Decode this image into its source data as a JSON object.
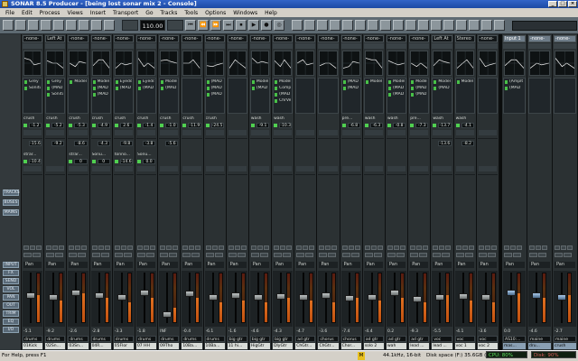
{
  "window": {
    "title": "SONAR 8.5 Producer - [being lost sonar mix 2 - Console]"
  },
  "menu": [
    "File",
    "Edit",
    "Process",
    "Views",
    "Insert",
    "Transport",
    "Go",
    "Tracks",
    "Tools",
    "Options",
    "Windows",
    "Help"
  ],
  "toolbar": {
    "now_time": "110.00"
  },
  "sidebar": [
    "TRACKS",
    "BUSES",
    "MAINS",
    "INPUT",
    "FX",
    "SEND",
    "VOL",
    "PAN",
    "OUT",
    "TRIM",
    "EQ",
    "I/O"
  ],
  "strips": [
    {
      "hdr": "-none-",
      "send": "crush",
      "send_val": "-1.2",
      "send2": "-15.6",
      "send3": "strar...",
      "send3_val": "-10.4",
      "pan": "Pan",
      "vol": "-5.1",
      "out": "drums",
      "name": "01Kick",
      "fx": [
        "Grey",
        "Sonitus"
      ],
      "meter": 0.55,
      "fader": 0.55
    },
    {
      "hdr": "Left At",
      "send": "crush",
      "send_val": "-5.2",
      "send2": "-9.2",
      "send3": "",
      "send3_val": "",
      "pan": "Pan",
      "vol": "-9.2",
      "out": "drums",
      "name": "02Sn...",
      "fx": [
        "Grey",
        "(MAD",
        "Sonitus"
      ],
      "meter": 0.45,
      "fader": 0.5
    },
    {
      "hdr": "-none-",
      "send": "crush",
      "send_val": "-5.3",
      "send2": "-8.6",
      "send3": "strar...",
      "send3_val": "0",
      "pan": "Pan",
      "vol": "-2.6",
      "out": "drums",
      "name": "03Sn...",
      "fx": [
        "Model"
      ],
      "meter": 0.6,
      "fader": 0.6
    },
    {
      "hdr": "-none-",
      "send": "crush",
      "send_val": "-4.9",
      "send2": "-4.3",
      "send3": "Sonu...",
      "send3_val": "0",
      "pan": "Pan",
      "vol": "-2.8",
      "out": "drums",
      "name": "04R...",
      "fx": [
        "Model",
        "(MAD",
        "(MAD"
      ],
      "meter": 0.5,
      "fader": 0.55
    },
    {
      "hdr": "-none-",
      "send": "crush",
      "send_val": "2.6",
      "send2": "-9.8",
      "send3": "tonno...",
      "send3_val": "-14.6",
      "pan": "Pan",
      "vol": "-3.3",
      "out": "drums",
      "name": "05Flor",
      "fx": [
        "Eyedd",
        "(MAD"
      ],
      "meter": 0.4,
      "fader": 0.5
    },
    {
      "hdr": "-none-",
      "send": "crush",
      "send_val": "-1.4",
      "send2": "-3.8",
      "send3": "Sonu...",
      "send3_val": "0.0",
      "pan": "Pan",
      "vol": "-1.8",
      "out": "drums",
      "name": "07 HH",
      "fx": [
        "Eyedd",
        "(MAD"
      ],
      "meter": 0.5,
      "fader": 0.6
    },
    {
      "hdr": "-none-",
      "send": "crush",
      "send_val": "-1.0",
      "send2": "-5.6",
      "send3": "",
      "send3_val": "",
      "pan": "Pan",
      "vol": "INF",
      "out": "drums",
      "name": "09Tho",
      "fx": [
        "Model",
        "(MAD"
      ],
      "meter": 0.3,
      "fader": 0.1
    },
    {
      "hdr": "-none-",
      "send": "crush",
      "send_val": "-11.9",
      "send2": "",
      "send3": "",
      "send3_val": "",
      "pan": "Pan",
      "vol": "-0.4",
      "out": "drums",
      "name": "10Ba...",
      "fx": [],
      "meter": 0.5,
      "fader": 0.58
    },
    {
      "hdr": "-none-",
      "send": "crush",
      "send_val": "-24.5",
      "send2": "",
      "send3": "",
      "send3_val": "",
      "pan": "Pan",
      "vol": "-6.1",
      "out": "drums",
      "name": "10Ba...",
      "fx": [
        "(MAD",
        "(MAD",
        "(MAD"
      ],
      "meter": 0.4,
      "fader": 0.5
    },
    {
      "hdr": "-none-",
      "send": "",
      "send_val": "",
      "send2": "",
      "send3": "",
      "send3_val": "",
      "pan": "Pan",
      "vol": "-1.6",
      "out": "big gtr",
      "name": "11 hi...",
      "fx": [],
      "meter": 0.45,
      "fader": 0.55
    },
    {
      "hdr": "-none-",
      "send": "wash",
      "send_val": "-9.1",
      "send2": "",
      "send3": "",
      "send3_val": "",
      "pan": "Pan",
      "vol": "-4.6",
      "out": "big gtr",
      "name": "HigGtr",
      "fx": [
        "Model",
        "(MAD"
      ],
      "meter": 0.4,
      "fader": 0.5
    },
    {
      "hdr": "-none-",
      "send": "wash",
      "send_val": "-10.3",
      "send2": "",
      "send3": "",
      "send3_val": "",
      "pan": "Pan",
      "vol": "-4.3",
      "out": "big gtr",
      "name": "DlyGtr",
      "fx": [
        "Model",
        "Compr",
        "(MAD",
        "ChrVerb"
      ],
      "meter": 0.5,
      "fader": 0.52
    },
    {
      "hdr": "-none-",
      "send": "",
      "send_val": "",
      "send2": "",
      "send3": "",
      "send3_val": "",
      "pan": "Pan",
      "vol": "-4.7",
      "out": "ad gtr",
      "name": "ChGtr...",
      "fx": [],
      "meter": 0.45,
      "fader": 0.5
    },
    {
      "hdr": "-none-",
      "send": "",
      "send_val": "",
      "send2": "",
      "send3": "",
      "send3_val": "",
      "pan": "Pan",
      "vol": "-3.6",
      "out": "chorus",
      "name": "ChGtr...",
      "fx": [],
      "meter": 0.4,
      "fader": 0.55
    },
    {
      "hdr": "-none-",
      "send": "pre...",
      "send_val": "-6.8",
      "send2": "",
      "send3": "",
      "send3_val": "",
      "pan": "Pan",
      "vol": "-7.4",
      "out": "chorus",
      "name": "Chor...",
      "fx": [
        "(MAD",
        "(MAD"
      ],
      "meter": 0.5,
      "fader": 0.48
    },
    {
      "hdr": "-none-",
      "send": "wash",
      "send_val": "-6.3",
      "send2": "",
      "send3": "",
      "send3_val": "",
      "pan": "Pan",
      "vol": "-4.4",
      "out": "ad gtr",
      "name": "solo 2",
      "fx": [
        "Model"
      ],
      "meter": 0.45,
      "fader": 0.5
    },
    {
      "hdr": "-none-",
      "send": "wash",
      "send_val": "-0.8",
      "send2": "",
      "send3": "",
      "send3_val": "",
      "pan": "Pan",
      "vol": "0.2",
      "out": "ad gtr",
      "name": "wah",
      "fx": [
        "Model",
        "(MAD",
        "(MAD"
      ],
      "meter": 0.5,
      "fader": 0.6
    },
    {
      "hdr": "-none-",
      "send": "pre...",
      "send_val": "-7.3",
      "send2": "",
      "send3": "",
      "send3_val": "",
      "pan": "Pan",
      "vol": "-9.3",
      "out": "ad gtr",
      "name": "lead ...",
      "fx": [
        "Model",
        "(MAD",
        "(MAD"
      ],
      "meter": 0.4,
      "fader": 0.45
    },
    {
      "hdr": "Left At",
      "send": "wash",
      "send_val": "-13.7",
      "send2": "-13.6",
      "send3": "",
      "send3_val": "",
      "pan": "Pan",
      "vol": "-5.5",
      "out": "voc",
      "name": "lead ...",
      "fx": [
        "Model",
        "(MAD"
      ],
      "meter": 0.55,
      "fader": 0.5
    },
    {
      "hdr": "Stereo",
      "send": "wash",
      "send_val": "-4.1",
      "send2": "-8.2",
      "send3": "",
      "send3_val": "",
      "pan": "Pan",
      "vol": "-4.1",
      "out": "voc",
      "name": "voc 1",
      "fx": [
        "Model"
      ],
      "meter": 0.45,
      "fader": 0.52
    },
    {
      "hdr": "-none-",
      "send": "",
      "send_val": "",
      "send2": "",
      "send3": "",
      "send3_val": "",
      "pan": "Pan",
      "vol": "-3.6",
      "out": "voc",
      "name": "voc 2",
      "fx": [],
      "meter": 0.4,
      "fader": 0.5
    }
  ],
  "buses": [
    {
      "hdr": "Input 1",
      "pan": "Pan",
      "vol": "0.0",
      "out": "AS10:...",
      "name": "mas...",
      "fx": [
        "(Amplt",
        "(MAD"
      ],
      "meter": 0.6,
      "fader": 0.6
    },
    {
      "hdr": "-none-",
      "pan": "Pan",
      "vol": "-4.6",
      "out": "maine",
      "name": "dru...",
      "fx": [],
      "meter": 0.5,
      "fader": 0.55
    },
    {
      "hdr": "-none-",
      "pan": "Pan",
      "vol": "-2.7",
      "out": "maine",
      "name": "crush",
      "fx": [],
      "meter": 0.55,
      "fader": 0.5
    }
  ],
  "status": {
    "help": "For Help, press F1",
    "m": "M",
    "format": "44.1kHz, 16-bit",
    "disk": "Disk space (F:) 35.6GB (47%)",
    "cpu": "CPU: 80%",
    "diskmeter": "Disk: 90%"
  }
}
